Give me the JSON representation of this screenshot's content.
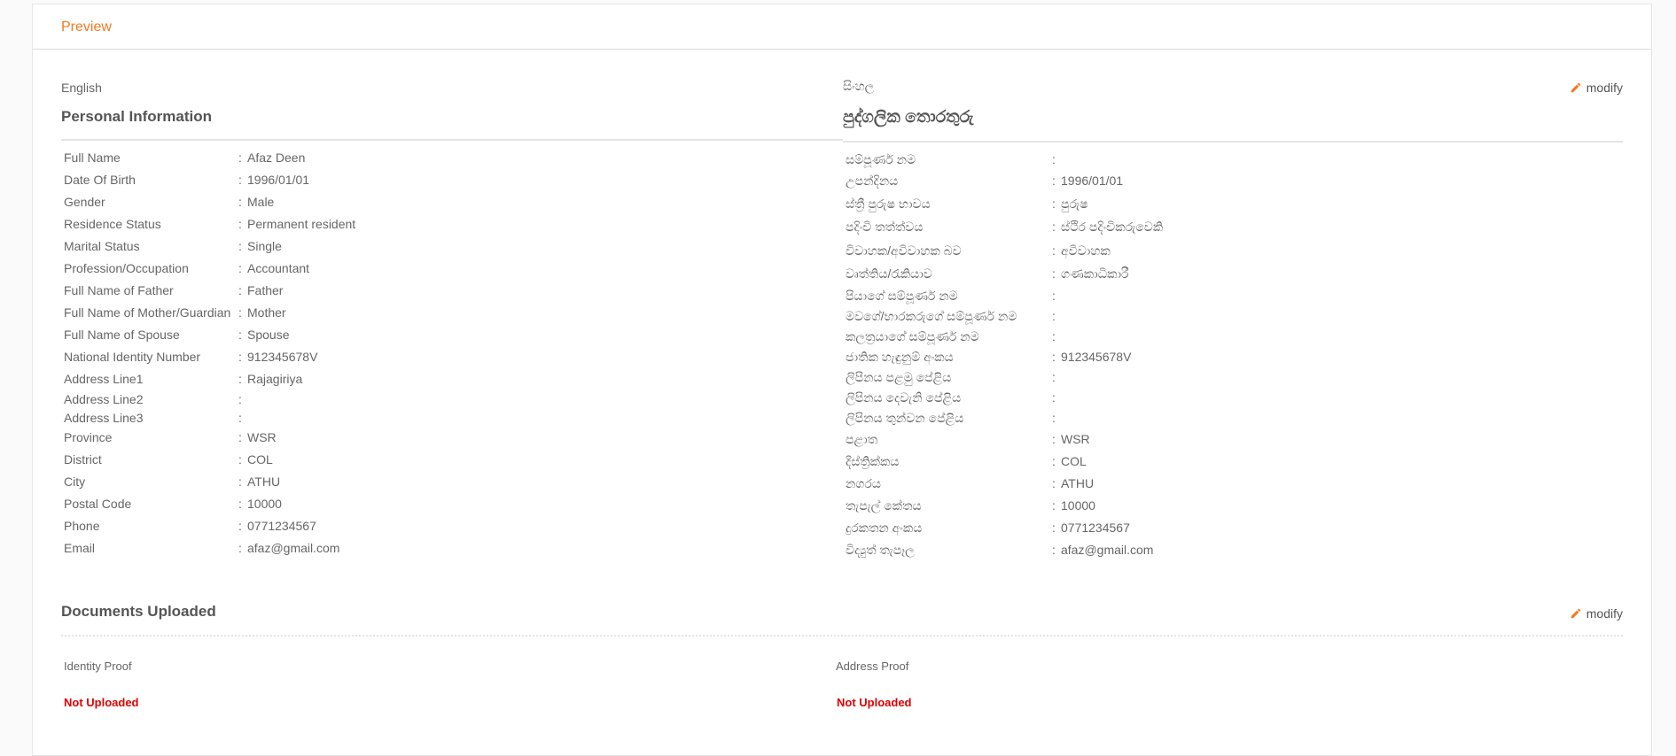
{
  "header": {
    "title": "Preview"
  },
  "english": {
    "lang": "English",
    "section_title": "Personal Information",
    "rows": [
      {
        "label": "Full Name",
        "value": "Afaz Deen"
      },
      {
        "label": "Date Of Birth",
        "value": "1996/01/01"
      },
      {
        "label": "Gender",
        "value": "Male"
      },
      {
        "label": "Residence Status",
        "value": "Permanent resident"
      },
      {
        "label": "Marital Status",
        "value": "Single"
      },
      {
        "label": "Profession/Occupation",
        "value": "Accountant"
      },
      {
        "label": "Full Name of Father",
        "value": "Father"
      },
      {
        "label": "Full Name of Mother/Guardian",
        "value": "Mother"
      },
      {
        "label": "Full Name of Spouse",
        "value": "Spouse"
      },
      {
        "label": "National Identity Number",
        "value": "912345678V"
      },
      {
        "label": "Address Line1",
        "value": "Rajagiriya"
      },
      {
        "label": "Address Line2",
        "value": ""
      },
      {
        "label": "Address Line3",
        "value": ""
      },
      {
        "label": "Province",
        "value": "WSR"
      },
      {
        "label": "District",
        "value": "COL"
      },
      {
        "label": "City",
        "value": "ATHU"
      },
      {
        "label": "Postal Code",
        "value": "10000"
      },
      {
        "label": "Phone",
        "value": "0771234567"
      },
      {
        "label": "Email",
        "value": "afaz@gmail.com"
      }
    ]
  },
  "sinhala": {
    "lang": "සිංහල",
    "section_title": "පුද්ගලික තොරතුරු",
    "modify_label": "modify",
    "rows": [
      {
        "label": "සම්පූර්ණ නම",
        "value": ""
      },
      {
        "label": "උපන්දිනය",
        "value": "1996/01/01"
      },
      {
        "label": "ස්ත්‍රී පුරුෂ භාවය",
        "value": "පුරුෂ"
      },
      {
        "label": "පදිංචි තත්ත්වය",
        "value": "ස්ථිර පදිංචිකරුවෙකි"
      },
      {
        "label": "විවාහක/අවිවාහක බව",
        "value": "අවිවාහක"
      },
      {
        "label": "වෘත්තිය/රැකියාව",
        "value": "ගණකාධිකාරී"
      },
      {
        "label": "පියාගේ සම්පූර්ණ නම",
        "value": ""
      },
      {
        "label": "මවගේ/භාරකරුගේ සම්පූර්ණ නම",
        "value": ""
      },
      {
        "label": "කලත්‍රයාගේ සම්පූර්ණ නම",
        "value": ""
      },
      {
        "label": "ජාතික හැඳුනුම් අංකය",
        "value": "912345678V"
      },
      {
        "label": "ලිපිනය පළමු පේළිය",
        "value": ""
      },
      {
        "label": "ලිපිනය දෙවැනි පේළිය",
        "value": ""
      },
      {
        "label": "ලිපිනය තුන්වන පේළිය",
        "value": ""
      },
      {
        "label": "පළාත",
        "value": "WSR"
      },
      {
        "label": "දිස්ත්‍රික්කය",
        "value": "COL"
      },
      {
        "label": "නගරය",
        "value": "ATHU"
      },
      {
        "label": "තැපැල් කේතය",
        "value": "10000"
      },
      {
        "label": "දුරකතන අංකය",
        "value": "0771234567"
      },
      {
        "label": "විද්‍යුත් තැපෑල",
        "value": "afaz@gmail.com"
      }
    ]
  },
  "documents": {
    "section_title": "Documents Uploaded",
    "modify_label": "modify",
    "identity_proof": {
      "label": "Identity Proof",
      "status": "Not Uploaded"
    },
    "address_proof": {
      "label": "Address Proof",
      "status": "Not Uploaded"
    }
  },
  "colors": {
    "accent": "#f47920",
    "status_error": "#e00000"
  },
  "icons": {
    "modify": "pencil-icon"
  }
}
